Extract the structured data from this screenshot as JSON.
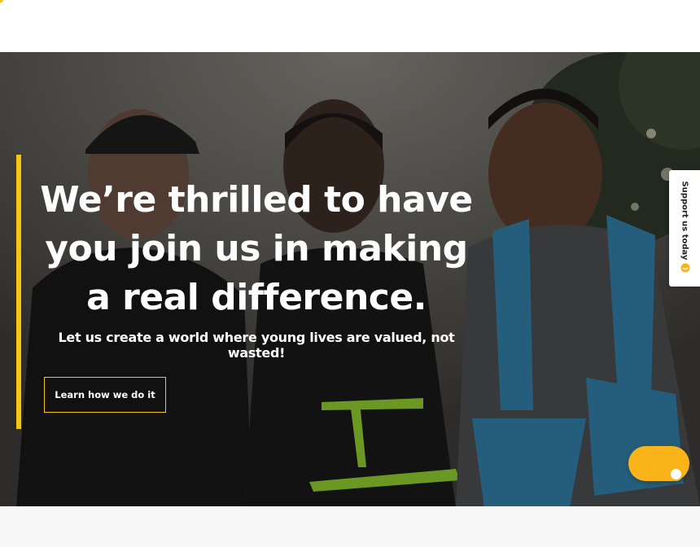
{
  "hero": {
    "headline_lines": [
      "We’re thrilled to have",
      "you join us in making",
      "a real difference."
    ],
    "subline": "Let us create a world where young lives are valued, not wasted!",
    "cta_label": "Learn how we do it"
  },
  "support_tab": {
    "label": "Support us today",
    "icon": "heart-hand-icon"
  },
  "chat_widget": {
    "icon": "chat-bubble-icon"
  },
  "colors": {
    "accent": "#f5c518",
    "chat": "#fbb31a",
    "text": "#ffffff"
  }
}
